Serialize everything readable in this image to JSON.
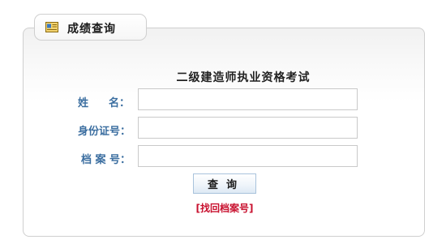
{
  "tab": {
    "icon": "certificate-icon",
    "title": "成绩查询"
  },
  "exam_title": "二级建造师执业资格考试",
  "form": {
    "name_label": "姓 名：",
    "name_label_left": "姓",
    "name_label_right": "名：",
    "id_label": "身份证号：",
    "file_label": "档 案 号：",
    "name_value": "",
    "id_value": "",
    "file_value": ""
  },
  "query_button_label": "查询",
  "retrieve_link": "[找回档案号]",
  "colors": {
    "label": "#3b6ea0",
    "link": "#c8102e",
    "border": "#cfcfcf"
  }
}
